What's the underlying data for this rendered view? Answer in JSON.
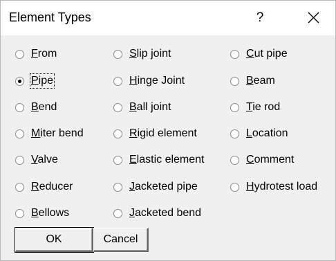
{
  "dialog": {
    "title": "Element Types",
    "help_glyph": "?",
    "close_icon": "close-icon"
  },
  "selected": "Pipe",
  "options": [
    {
      "label": "From",
      "ul": "F",
      "rest": "rom",
      "pre": "",
      "checked": false
    },
    {
      "label": "Pipe",
      "ul": "P",
      "rest": "ipe",
      "pre": "",
      "checked": true
    },
    {
      "label": "Bend",
      "ul": "B",
      "rest": "end",
      "pre": "",
      "checked": false
    },
    {
      "label": "Miter bend",
      "ul": "M",
      "rest": "iter bend",
      "pre": "",
      "checked": false
    },
    {
      "label": "Valve",
      "ul": "V",
      "rest": "alve",
      "pre": "",
      "checked": false
    },
    {
      "label": "Reducer",
      "ul": "R",
      "rest": "educer",
      "pre": "",
      "checked": false
    },
    {
      "label": "Bellows",
      "ul": "B",
      "rest": "ellows",
      "pre": "",
      "checked": false
    },
    {
      "label": "Slip joint",
      "ul": "S",
      "rest": "lip joint",
      "pre": "",
      "checked": false
    },
    {
      "label": "Hinge Joint",
      "ul": "H",
      "rest": "inge Joint",
      "pre": "",
      "checked": false
    },
    {
      "label": "Ball joint",
      "ul": "B",
      "rest": "all joint",
      "pre": "",
      "checked": false
    },
    {
      "label": "Rigid element",
      "ul": "R",
      "rest": "igid element",
      "pre": "",
      "checked": false
    },
    {
      "label": "Elastic element",
      "ul": "E",
      "rest": "lastic element",
      "pre": "",
      "checked": false
    },
    {
      "label": "Jacketed pipe",
      "ul": "J",
      "rest": "acketed pipe",
      "pre": "",
      "checked": false
    },
    {
      "label": "Jacketed bend",
      "ul": "J",
      "rest": "acketed bend",
      "pre": "",
      "checked": false
    },
    {
      "label": "Cut pipe",
      "ul": "C",
      "rest": "ut pipe",
      "pre": "",
      "checked": false
    },
    {
      "label": "Beam",
      "ul": "B",
      "rest": "eam",
      "pre": "",
      "checked": false
    },
    {
      "label": "Tie rod",
      "ul": "T",
      "rest": "ie rod",
      "pre": "",
      "checked": false
    },
    {
      "label": "Location",
      "ul": "L",
      "rest": "ocation",
      "pre": "",
      "checked": false
    },
    {
      "label": "Comment",
      "ul": "C",
      "rest": "omment",
      "pre": "",
      "checked": false
    },
    {
      "label": "Hydrotest load",
      "ul": "H",
      "rest": "ydrotest load",
      "pre": "",
      "checked": false
    }
  ],
  "buttons": {
    "ok": "OK",
    "cancel": "Cancel"
  }
}
